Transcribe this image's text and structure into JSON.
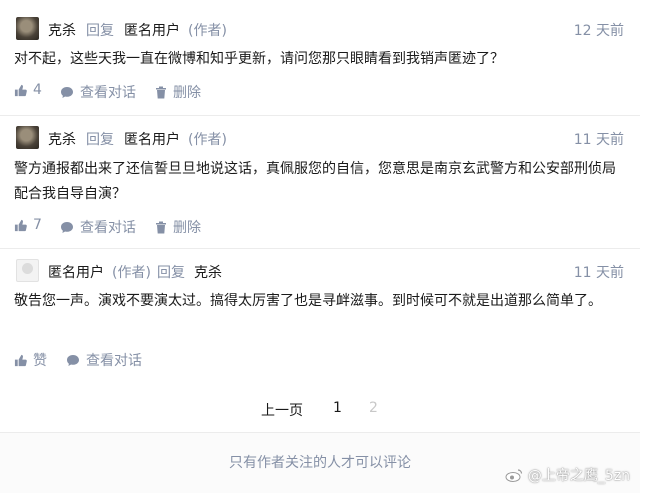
{
  "comments": [
    {
      "author": "克杀",
      "reply_label": "回复",
      "reply_to": "匿名用户",
      "author_tag": "(作者)",
      "time": "12 天前",
      "text": "对不起，这些天我一直在微博和知乎更新，请问您那只眼睛看到我销声匿迹了？",
      "likes": "4",
      "view_convo": "查看对话",
      "delete": "删除"
    },
    {
      "author": "克杀",
      "reply_label": "回复",
      "reply_to": "匿名用户",
      "author_tag": "(作者)",
      "time": "11 天前",
      "text": "警方通报都出来了还信誓旦旦地说这话，真佩服您的自信，您意思是南京玄武警方和公安部刑侦局配合我自导自演？",
      "likes": "7",
      "view_convo": "查看对话",
      "delete": "删除"
    },
    {
      "author": "匿名用户",
      "author_tag": "(作者)",
      "reply_label": "回复",
      "reply_to": "克杀",
      "time": "11 天前",
      "text": "敬告您一声。演戏不要演太过。搞得太厉害了也是寻衅滋事。到时候可不就是出道那么简单了。",
      "likes": "赞",
      "view_convo": "查看对话"
    }
  ],
  "pagination": {
    "prev": "上一页",
    "page1": "1",
    "page2": "2"
  },
  "footer": {
    "notice": "只有作者关注的人才可以评论"
  },
  "watermark": {
    "text": "@上帝之鹰_5zn"
  },
  "colors": {
    "meta": "#8590a6",
    "text": "#1a1a1a",
    "divider": "#ececec"
  }
}
